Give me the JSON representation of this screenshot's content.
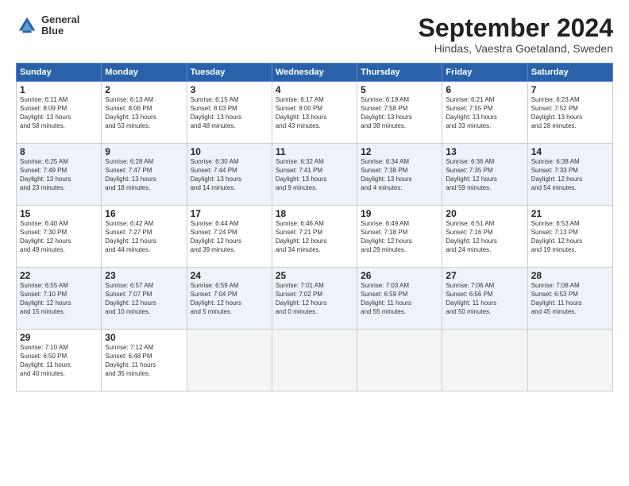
{
  "header": {
    "logo_line1": "General",
    "logo_line2": "Blue",
    "month": "September 2024",
    "location": "Hindas, Vaestra Goetaland, Sweden"
  },
  "days_of_week": [
    "Sunday",
    "Monday",
    "Tuesday",
    "Wednesday",
    "Thursday",
    "Friday",
    "Saturday"
  ],
  "weeks": [
    [
      {
        "day": "1",
        "info": "Sunrise: 6:11 AM\nSunset: 8:09 PM\nDaylight: 13 hours\nand 58 minutes."
      },
      {
        "day": "2",
        "info": "Sunrise: 6:13 AM\nSunset: 8:06 PM\nDaylight: 13 hours\nand 53 minutes."
      },
      {
        "day": "3",
        "info": "Sunrise: 6:15 AM\nSunset: 8:03 PM\nDaylight: 13 hours\nand 48 minutes."
      },
      {
        "day": "4",
        "info": "Sunrise: 6:17 AM\nSunset: 8:00 PM\nDaylight: 13 hours\nand 43 minutes."
      },
      {
        "day": "5",
        "info": "Sunrise: 6:19 AM\nSunset: 7:58 PM\nDaylight: 13 hours\nand 38 minutes."
      },
      {
        "day": "6",
        "info": "Sunrise: 6:21 AM\nSunset: 7:55 PM\nDaylight: 13 hours\nand 33 minutes."
      },
      {
        "day": "7",
        "info": "Sunrise: 6:23 AM\nSunset: 7:52 PM\nDaylight: 13 hours\nand 28 minutes."
      }
    ],
    [
      {
        "day": "8",
        "info": "Sunrise: 6:25 AM\nSunset: 7:49 PM\nDaylight: 13 hours\nand 23 minutes."
      },
      {
        "day": "9",
        "info": "Sunrise: 6:28 AM\nSunset: 7:47 PM\nDaylight: 13 hours\nand 18 minutes."
      },
      {
        "day": "10",
        "info": "Sunrise: 6:30 AM\nSunset: 7:44 PM\nDaylight: 13 hours\nand 14 minutes."
      },
      {
        "day": "11",
        "info": "Sunrise: 6:32 AM\nSunset: 7:41 PM\nDaylight: 13 hours\nand 9 minutes."
      },
      {
        "day": "12",
        "info": "Sunrise: 6:34 AM\nSunset: 7:38 PM\nDaylight: 13 hours\nand 4 minutes."
      },
      {
        "day": "13",
        "info": "Sunrise: 6:36 AM\nSunset: 7:35 PM\nDaylight: 12 hours\nand 59 minutes."
      },
      {
        "day": "14",
        "info": "Sunrise: 6:38 AM\nSunset: 7:33 PM\nDaylight: 12 hours\nand 54 minutes."
      }
    ],
    [
      {
        "day": "15",
        "info": "Sunrise: 6:40 AM\nSunset: 7:30 PM\nDaylight: 12 hours\nand 49 minutes."
      },
      {
        "day": "16",
        "info": "Sunrise: 6:42 AM\nSunset: 7:27 PM\nDaylight: 12 hours\nand 44 minutes."
      },
      {
        "day": "17",
        "info": "Sunrise: 6:44 AM\nSunset: 7:24 PM\nDaylight: 12 hours\nand 39 minutes."
      },
      {
        "day": "18",
        "info": "Sunrise: 6:46 AM\nSunset: 7:21 PM\nDaylight: 12 hours\nand 34 minutes."
      },
      {
        "day": "19",
        "info": "Sunrise: 6:49 AM\nSunset: 7:18 PM\nDaylight: 12 hours\nand 29 minutes."
      },
      {
        "day": "20",
        "info": "Sunrise: 6:51 AM\nSunset: 7:16 PM\nDaylight: 12 hours\nand 24 minutes."
      },
      {
        "day": "21",
        "info": "Sunrise: 6:53 AM\nSunset: 7:13 PM\nDaylight: 12 hours\nand 19 minutes."
      }
    ],
    [
      {
        "day": "22",
        "info": "Sunrise: 6:55 AM\nSunset: 7:10 PM\nDaylight: 12 hours\nand 15 minutes."
      },
      {
        "day": "23",
        "info": "Sunrise: 6:57 AM\nSunset: 7:07 PM\nDaylight: 12 hours\nand 10 minutes."
      },
      {
        "day": "24",
        "info": "Sunrise: 6:59 AM\nSunset: 7:04 PM\nDaylight: 12 hours\nand 5 minutes."
      },
      {
        "day": "25",
        "info": "Sunrise: 7:01 AM\nSunset: 7:02 PM\nDaylight: 12 hours\nand 0 minutes."
      },
      {
        "day": "26",
        "info": "Sunrise: 7:03 AM\nSunset: 6:59 PM\nDaylight: 11 hours\nand 55 minutes."
      },
      {
        "day": "27",
        "info": "Sunrise: 7:06 AM\nSunset: 6:56 PM\nDaylight: 11 hours\nand 50 minutes."
      },
      {
        "day": "28",
        "info": "Sunrise: 7:08 AM\nSunset: 6:53 PM\nDaylight: 11 hours\nand 45 minutes."
      }
    ],
    [
      {
        "day": "29",
        "info": "Sunrise: 7:10 AM\nSunset: 6:50 PM\nDaylight: 11 hours\nand 40 minutes."
      },
      {
        "day": "30",
        "info": "Sunrise: 7:12 AM\nSunset: 6:48 PM\nDaylight: 11 hours\nand 35 minutes."
      },
      {
        "day": "",
        "info": ""
      },
      {
        "day": "",
        "info": ""
      },
      {
        "day": "",
        "info": ""
      },
      {
        "day": "",
        "info": ""
      },
      {
        "day": "",
        "info": ""
      }
    ]
  ]
}
